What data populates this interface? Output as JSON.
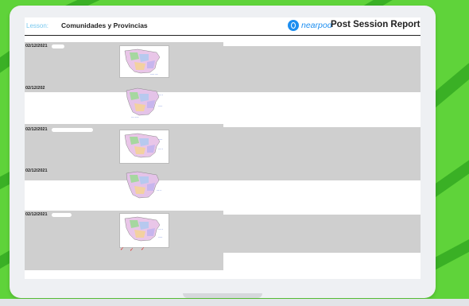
{
  "header": {
    "lesson_label": "Lesson:",
    "lesson_title": "Comunidades y Provincias",
    "brand": "nearpod",
    "report_title": "Post Session Report"
  },
  "entries": [
    {
      "date": "02/12/2021"
    },
    {
      "date": "02/12/202"
    },
    {
      "date": "02/12/2021"
    },
    {
      "date": "02/12/2021"
    },
    {
      "date": "02/12/2021"
    }
  ],
  "colors": {
    "background": "#5fd33a",
    "frame": "#eef0f3",
    "row_shade": "#cfcfcf",
    "brand_blue": "#1d8ef0",
    "lesson_label_color": "#78c8ee"
  }
}
